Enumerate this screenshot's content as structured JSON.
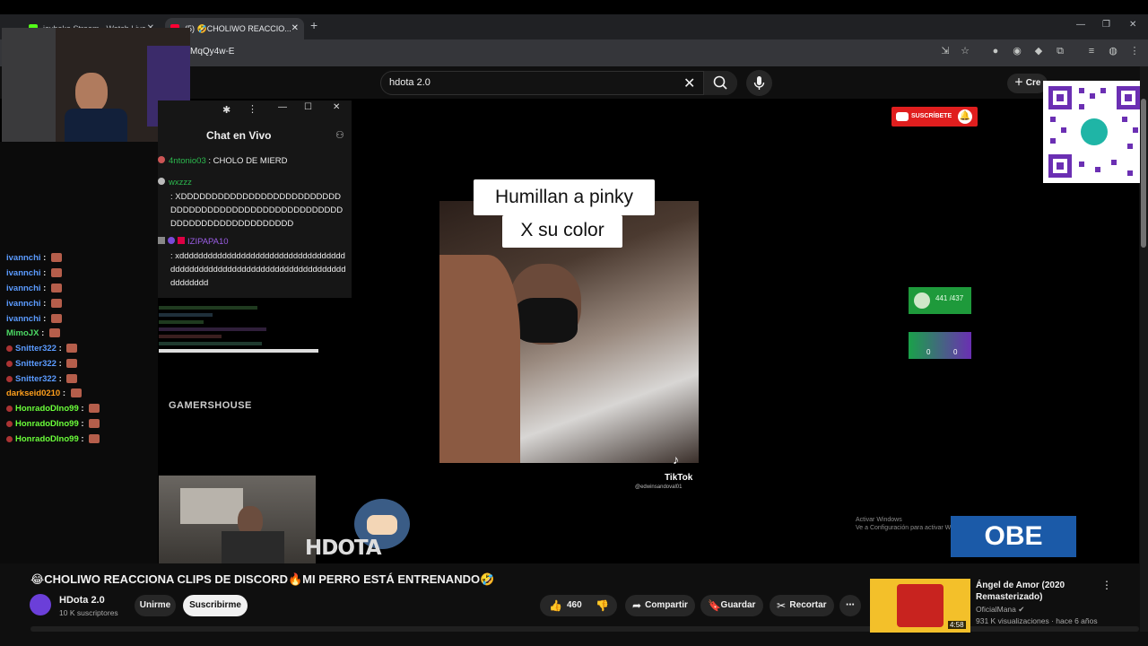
{
  "browser": {
    "tabs": [
      {
        "title": "javbaka Stream - Watch Live...",
        "favicon_color": "#53fc18"
      },
      {
        "title": "(5) 🤣CHOLIWO REACCIO...",
        "favicon_color": "#ff0033"
      }
    ],
    "url_fragment": "MqQy4w-E"
  },
  "youtube": {
    "search_value": "hdota 2.0",
    "create_label": "Cre",
    "notification_count": "5"
  },
  "overlay_chat": {
    "title": "Chat en Vivo",
    "messages": [
      {
        "user": "4ntonio03",
        "text": ": CHOLO DE MIERD",
        "color": "#2cb84e"
      },
      {
        "user": "wxzzz",
        "text": ": XDDDDDDDDDDDDDDDDDDDDDDDDDDDDDDDDDDDDDDDDDDDDDDDDDDDDDDDDDDDDDDDDDDDDDDDDDD",
        "color": "#2cb84e"
      },
      {
        "user": "IZIPAPA10",
        "text": ": xdddddddddddddddddddddddddddddddddddddddddddddddddddddddddddddddddddddddddddddddd",
        "color": "#9b5de5"
      }
    ]
  },
  "side_chat": [
    {
      "user": "ivannchi",
      "color": "#5b9bff"
    },
    {
      "user": "ivannchi",
      "color": "#5b9bff"
    },
    {
      "user": "ivannchi",
      "color": "#5b9bff"
    },
    {
      "user": "ivannchi",
      "color": "#5b9bff"
    },
    {
      "user": "ivannchi",
      "color": "#5b9bff"
    },
    {
      "user": "MimoJX",
      "color": "#4cd964"
    },
    {
      "user": "Snitter322",
      "color": "#5b9bff"
    },
    {
      "user": "Snitter322",
      "color": "#5b9bff"
    },
    {
      "user": "Snitter322",
      "color": "#5b9bff"
    },
    {
      "user": "darkseid0210",
      "color": "#ff9f1c"
    },
    {
      "user": "HonradoDIno99",
      "color": "#6bff3a"
    },
    {
      "user": "HonradoDIno99",
      "color": "#6bff3a"
    },
    {
      "user": "HonradoDIno99",
      "color": "#6bff3a"
    }
  ],
  "video_overlay": {
    "caption_line1": "Humillan a pinky",
    "caption_line2": "X su color",
    "subscribe_badge": "SUSCRÍBETE",
    "tiktok_label": "TikTok",
    "tiktok_handle": "@edwinsandoval01",
    "counter1": "441 /437",
    "counter2_left": "0",
    "counter2_right": "0",
    "gamers_house": "GAMERSHOUSE",
    "hdota_wm": "HDOTA",
    "obe": "OBE",
    "windows_activate_1": "Activar Windows",
    "windows_activate_2": "Ve a Configuración para activar Windows."
  },
  "video_info": {
    "title": "😂CHOLIWO REACCIONA CLIPS DE DISCORD🔥MI PERRO ESTÁ ENTRENANDO🤣",
    "channel": "HDota 2.0",
    "subscribers": "10 K suscriptores",
    "join": "Unirme",
    "subscribe": "Suscribirme",
    "likes": "460",
    "share": "Compartir",
    "save": "Guardar",
    "clip": "Recortar"
  },
  "recommendation": {
    "title": "Ángel de Amor (2020 Remasterizado)",
    "channel": "OficialMana",
    "meta": "931 K visualizaciones · hace 6 años",
    "duration": "4:58"
  }
}
